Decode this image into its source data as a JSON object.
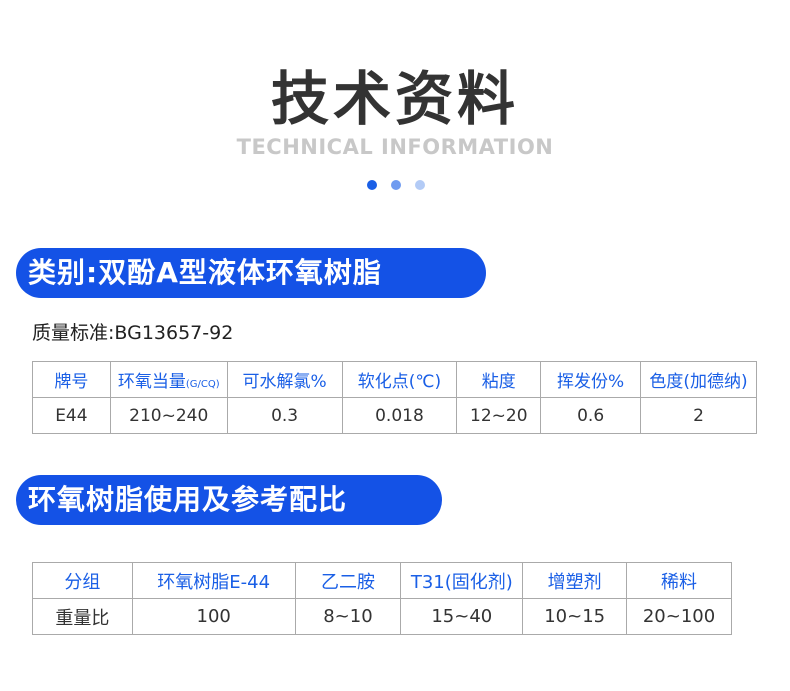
{
  "header": {
    "title": "技术资料",
    "subtitle": "TECHNICAL INFORMATION"
  },
  "section1": {
    "heading": "类别:双酚A型液体环氧树脂",
    "standard": "质量标准:BG13657-92",
    "table": {
      "headers": [
        "牌号",
        "环氧当量",
        "可水解氯%",
        "软化点(℃)",
        "粘度",
        "挥发份%",
        "色度(加德纳)"
      ],
      "header_unit": "(G/CQ)",
      "row": [
        "E44",
        "210~240",
        "0.3",
        "0.018",
        "12~20",
        "0.6",
        "2"
      ]
    }
  },
  "section2": {
    "heading": "环氧树脂使用及参考配比",
    "table": {
      "headers": [
        "分组",
        "环氧树脂E-44",
        "乙二胺",
        "T31(固化剂)",
        "增塑剂",
        "稀料"
      ],
      "row": [
        "重量比",
        "100",
        "8~10",
        "15~40",
        "10~15",
        "20~100"
      ]
    }
  },
  "colors": {
    "accent": "#1452e6",
    "header_text": "#1a5fe6",
    "subtitle": "#c8c8c8"
  }
}
